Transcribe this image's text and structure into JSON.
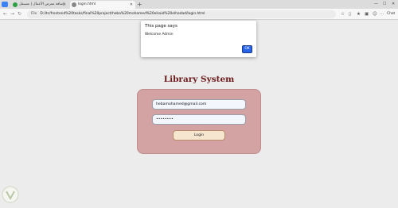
{
  "browser": {
    "tabs": [
      {
        "label": "إضافة معرض الأعمال | مستقل",
        "active": false
      },
      {
        "label": "login.html",
        "active": true
      }
    ],
    "url_label": "File",
    "url": "D:/itc/frontend%20tasks/final%20project/heba%20mohamed%20elsaid%20elhadad/login.html",
    "copilot_label": "Chat"
  },
  "alert": {
    "title": "This page says",
    "message": "Welcome Admin",
    "ok_label": "OK"
  },
  "page": {
    "title": "Library System",
    "email_value": "hebamohamed@gmail.com",
    "password_value": "••••••••",
    "login_label": "Login"
  },
  "colors": {
    "title": "#6b1a1a",
    "card": "#d3a2a2",
    "button": "#f7e6cf",
    "alert_ok": "#2563eb"
  }
}
